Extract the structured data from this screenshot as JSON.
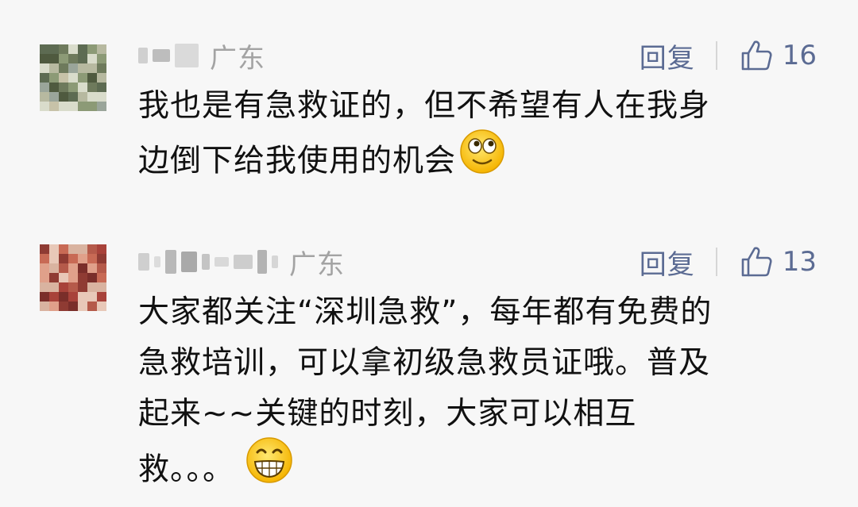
{
  "comments": [
    {
      "location": "广东",
      "reply_label": "回复",
      "likes": "16",
      "text_lines": [
        "我也是有急救证的，但不希望有人在我身",
        "边倒下给我使用的机会"
      ],
      "emoji": "eyes-roll-smile-icon"
    },
    {
      "location": "广东",
      "reply_label": "回复",
      "likes": "13",
      "text_lines": [
        "大家都关注“深圳急救”，每年都有免费的",
        "急救培训，可以拿初级急救员证哦。普及",
        "起来~~关键的时刻，大家可以相互",
        "救。。。"
      ],
      "emoji": "grinning-teeth-icon"
    }
  ],
  "colors": {
    "background": "#f7f7f7",
    "text": "#111111",
    "muted": "#a3a3a3",
    "action": "#5b6b93"
  }
}
